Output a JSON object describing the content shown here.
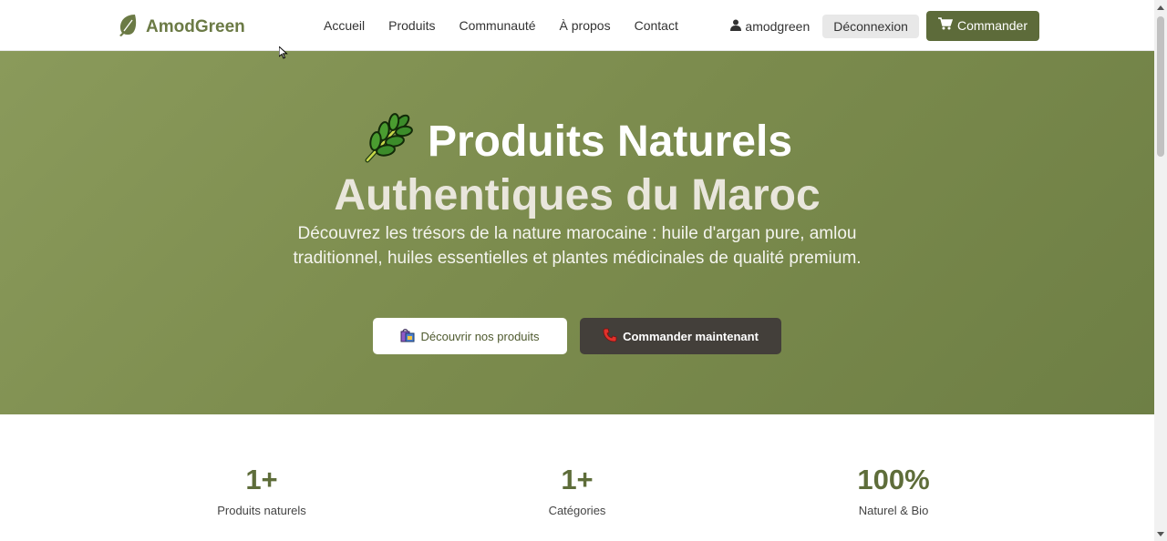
{
  "navbar": {
    "brand": "AmodGreen",
    "links": [
      "Accueil",
      "Produits",
      "Communauté",
      "À propos",
      "Contact"
    ],
    "user": "amodgreen",
    "logout_label": "Déconnexion",
    "order_label": "Commander"
  },
  "hero": {
    "title_line1": "Produits Naturels",
    "title_line2": "Authentiques du Maroc",
    "description": "Découvrez les trésors de la nature marocaine : huile d'argan pure, amlou traditionnel, huiles essentielles et plantes médicinales de qualité premium.",
    "btn_discover": "Découvrir nos produits",
    "btn_order": "Commander maintenant"
  },
  "stats": [
    {
      "value": "1+",
      "label": "Produits naturels"
    },
    {
      "value": "1+",
      "label": "Catégories"
    },
    {
      "value": "100%",
      "label": "Naturel & Bio"
    }
  ],
  "colors": {
    "accent": "#5e6d3a",
    "hero_bg": "#7b8b4d",
    "dark_button": "#433f3a"
  },
  "icons": {
    "brand": "leaf-icon",
    "hero": "herb-icon",
    "user": "user-icon",
    "cart": "cart-icon",
    "discover": "shopping-bags-icon",
    "phone": "phone-icon"
  }
}
